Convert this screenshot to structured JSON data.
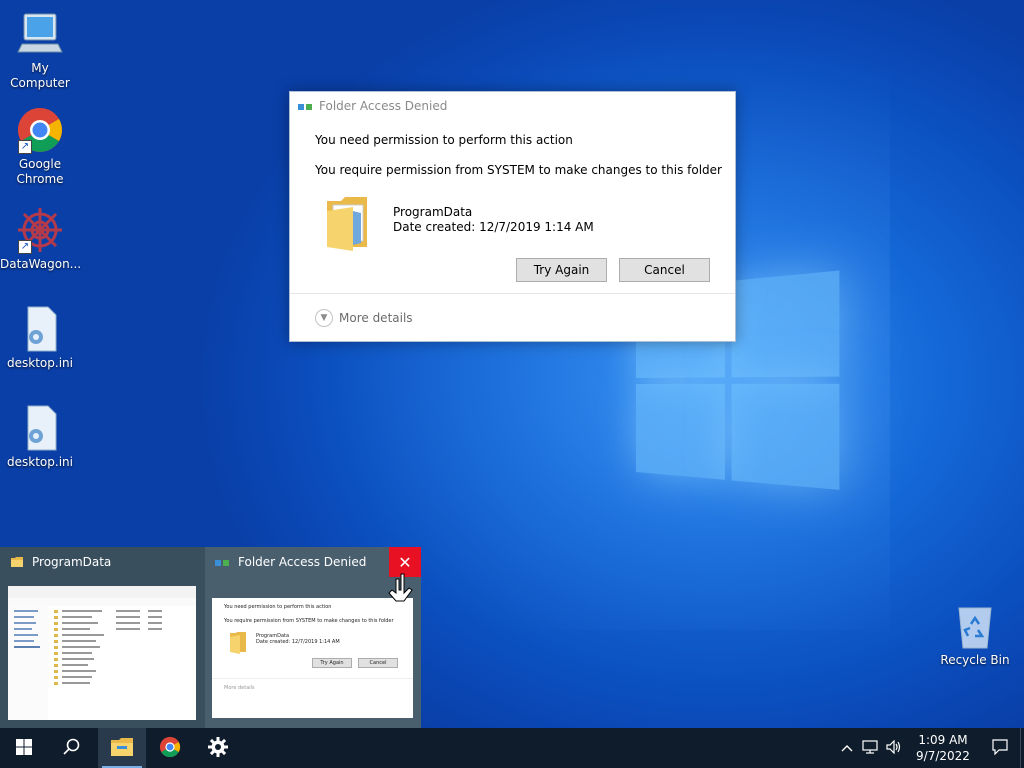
{
  "desktop": {
    "icons": [
      {
        "label": "My Computer"
      },
      {
        "label": "Google Chrome"
      },
      {
        "label": "DataWagon..."
      },
      {
        "label": "desktop.ini"
      },
      {
        "label": "desktop.ini"
      },
      {
        "label": "Recycle Bin"
      }
    ]
  },
  "dialog": {
    "title": "Folder Access Denied",
    "heading": "You need permission to perform this action",
    "message": "You require permission from SYSTEM to make changes to this folder",
    "file_name": "ProgramData",
    "date_created": "Date created: 12/7/2019 1:14 AM",
    "try_again_label": "Try Again",
    "cancel_label": "Cancel",
    "more_details_label": "More details"
  },
  "thumbnails": {
    "explorer_title": "ProgramData",
    "dialog_title": "Folder Access Denied",
    "close_glyph": "✕"
  },
  "taskbar": {
    "time": "1:09 AM",
    "date": "9/7/2022"
  },
  "colors": {
    "accent": "#0078d7",
    "close_red": "#e81123",
    "taskbar": "#0f1c2b"
  }
}
